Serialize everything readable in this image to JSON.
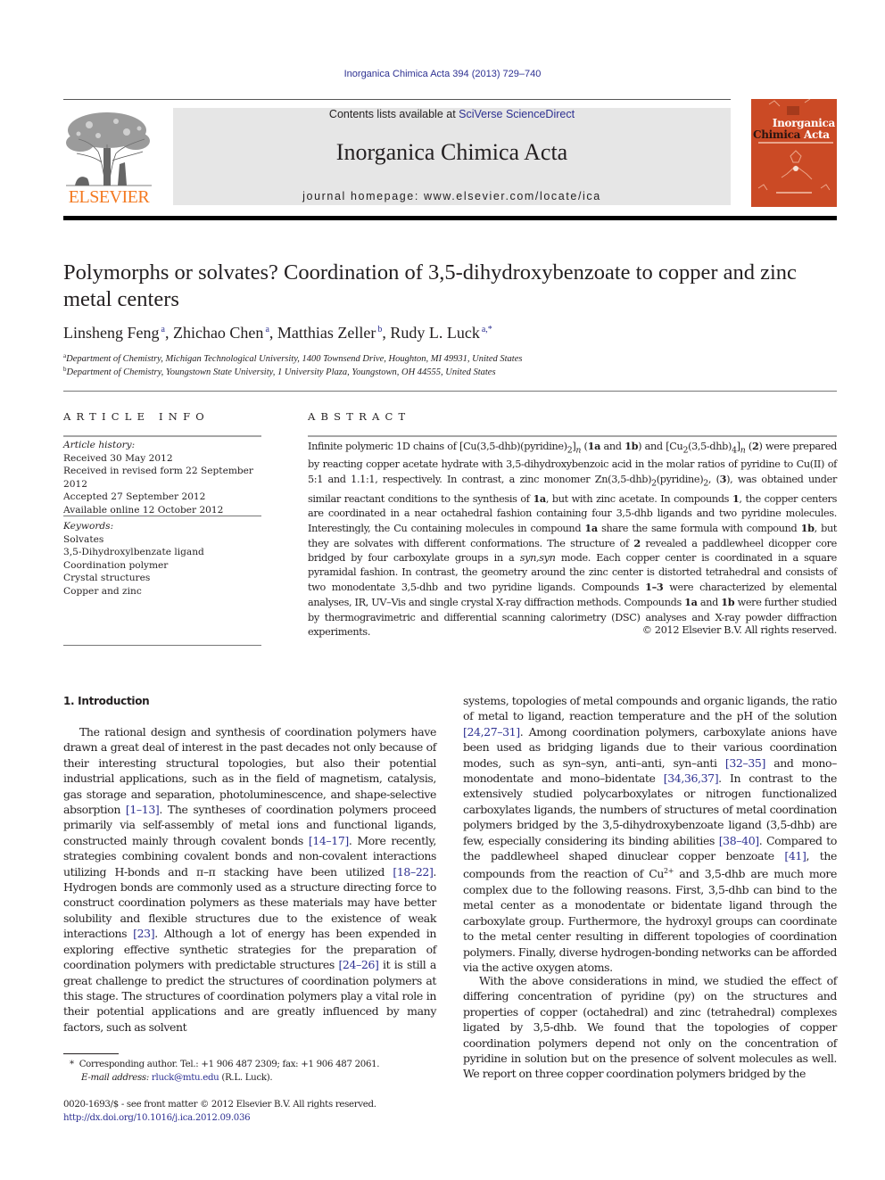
{
  "header": {
    "citation": "Inorganica Chimica Acta 394 (2013) 729–740",
    "publisher_logo_text": "ELSEVIER",
    "contents_prefix": "Contents lists available at ",
    "contents_link": "SciVerse ScienceDirect",
    "journal_title": "Inorganica Chimica Acta",
    "homepage_prefix": "journal homepage: ",
    "homepage_url": "www.elsevier.com/locate/ica",
    "cover": {
      "line1": "Inorganica",
      "line2_dark": "Chimica",
      "line2_light": " Acta",
      "color": "#cb4a25"
    },
    "logo_color": "#f47920",
    "link_color": "#2e3192"
  },
  "article": {
    "title": "Polymorphs or solvates? Coordination of 3,5-dihydroxybenzoate to copper and zinc metal centers",
    "authors": [
      {
        "name": "Linsheng Feng",
        "aff": "a"
      },
      {
        "name": "Zhichao Chen",
        "aff": "a"
      },
      {
        "name": "Matthias Zeller",
        "aff": "b"
      },
      {
        "name": "Rudy L. Luck",
        "aff": "a,*"
      }
    ],
    "affiliations": [
      {
        "mark": "a",
        "text": "Department of Chemistry, Michigan Technological University, 1400 Townsend Drive, Houghton, MI 49931, United States"
      },
      {
        "mark": "b",
        "text": "Department of Chemistry, Youngstown State University, 1 University Plaza, Youngstown, OH 44555, United States"
      }
    ]
  },
  "article_info": {
    "heading": "ARTICLE INFO",
    "history_label": "Article history:",
    "history": [
      "Received 30 May 2012",
      "Received in revised form 22 September 2012",
      "Accepted 27 September 2012",
      "Available online 12 October 2012"
    ],
    "keywords_label": "Keywords:",
    "keywords": [
      "Solvates",
      "3,5-Dihydroxylbenzate ligand",
      "Coordination polymer",
      "Crystal structures",
      "Copper and zinc"
    ]
  },
  "abstract": {
    "heading": "ABSTRACT",
    "segments": {
      "s1": "Infinite polymeric 1D chains of [Cu(3,5-dhb)(pyridine)",
      "s1_sub": "2",
      "s1b": "]",
      "s1_n": "n",
      "s2": " (",
      "b1a": "1a",
      "s3": " and ",
      "b1b": "1b",
      "s4": ") and [Cu",
      "s4_sub": "2",
      "s5": "(3,5-dhb)",
      "s5_sub": "4",
      "s5b": "]",
      "s5_n": "n",
      "s6": " (",
      "b2": "2",
      "s7": ") were prepared by reacting copper acetate hydrate with 3,5-dihydroxybenzoic acid in the molar ratios of pyridine to Cu(II) of 5:1 and 1.1:1, respectively. In contrast, a zinc monomer Zn(3,5-dhb)",
      "s7_sub": "2",
      "s8": "(pyridine)",
      "s8_sub": "2",
      "s9": ", (",
      "b3": "3",
      "s10": "), was obtained under similar reactant conditions to the synthesis of ",
      "b1a_2": "1a",
      "s11": ", but with zinc acetate. In compounds ",
      "b1": "1",
      "s12": ", the copper centers are coordinated in a near octahedral fashion containing four 3,5-dhb ligands and two pyridine molecules. Interestingly, the Cu containing molecules in compound ",
      "b1a_3": "1a",
      "s13": " share the same formula with compound ",
      "b1b_2": "1b",
      "s14": ", but they are solvates with different conformations. The structure of ",
      "b2_2": "2",
      "s15": " revealed a paddlewheel dicopper core bridged by four carboxylate groups in a ",
      "i_synsyn": "syn,syn",
      "s16": " mode. Each copper center is coordinated in a square pyramidal fashion. In contrast, the geometry around the zinc center is distorted tetrahedral and consists of two monodentate 3,5-dhb and two pyridine ligands. Compounds ",
      "b13": "1–3",
      "s17": " were characterized by elemental analyses, IR, UV–Vis and single crystal X-ray diffraction methods. Compounds ",
      "b1a_4": "1a",
      "s18": " and ",
      "b1b_3": "1b",
      "s19": " were further studied by thermogravimetric and differential scanning calorimetry (DSC) analyses and X-ray powder diffraction experiments."
    },
    "copyright": "© 2012 Elsevier B.V. All rights reserved."
  },
  "body": {
    "section_heading": "1. Introduction",
    "left": {
      "t1": "The rational design and synthesis of coordination polymers have drawn a great deal of interest in the past decades not only because of their interesting structural topologies, but also their potential industrial applications, such as in the field of magnetism, catalysis, gas storage and separation, photoluminescence, and shape-selective absorption ",
      "r1": "[1–13]",
      "t2": ". The syntheses of coordination polymers proceed primarily via self-assembly of metal ions and functional ligands, constructed mainly through covalent bonds ",
      "r2": "[14–17]",
      "t3": ". More recently, strategies combining covalent bonds and non-covalent interactions utilizing H-bonds and π–π stacking have been utilized ",
      "r3": "[18–22]",
      "t4": ". Hydrogen bonds are commonly used as a structure directing force to construct coordination polymers as these materials may have better solubility and flexible structures due to the existence of weak interactions ",
      "r4": "[23]",
      "t5": ". Although a lot of energy has been expended in exploring effective synthetic strategies for the preparation of coordination polymers with predictable structures ",
      "r5": "[24–26]",
      "t6": " it is still a great challenge to predict the structures of coordination polymers at this stage. The structures of coordination polymers play a vital role in their potential applications and are greatly influenced by many factors, such as solvent"
    },
    "right1": {
      "t1": "systems, topologies of metal compounds and organic ligands, the ratio of metal to ligand, reaction temperature and the pH of the solution ",
      "r1": "[24,27–31]",
      "t2": ". Among coordination polymers, carboxylate anions have been used as bridging ligands due to their various coordination modes, such as syn–syn, anti–anti, syn–anti ",
      "r2": "[32–35]",
      "t3": " and mono–monodentate and mono–bidentate ",
      "r3": "[34,36,37]",
      "t4": ". In contrast to the extensively studied polycarboxylates or nitrogen functionalized carboxylates ligands, the numbers of structures of metal coordination polymers bridged by the 3,5-dihydroxybenzoate ligand (3,5-dhb) are few, especially considering its binding abilities ",
      "r4": "[38–40]",
      "t5": ". Compared to the paddlewheel shaped dinuclear copper benzoate ",
      "r5": "[41]",
      "t6": ", the compounds from the reaction of Cu",
      "sup": "2+",
      "t7": " and 3,5-dhb are much more complex due to the following reasons. First, 3,5-dhb can bind to the metal center as a monodentate or bidentate ligand through the carboxylate group. Furthermore, the hydroxyl groups can coordinate to the metal center resulting in different topologies of coordination polymers. Finally, diverse hydrogen-bonding networks can be afforded via the active oxygen atoms."
    },
    "right2": {
      "t1": "With the above considerations in mind, we studied the effect of differing concentration of pyridine (py) on the structures and properties of copper (octahedral) and zinc (tetrahedral) complexes ligated by 3,5-dhb. We found that the topologies of copper coordination polymers depend not only on the concentration of pyridine in solution but on the presence of solvent molecules as well. We report on three copper coordination polymers bridged by the"
    }
  },
  "footnotes": {
    "star": "*",
    "corresponding": "Corresponding author. Tel.: +1 906 487 2309; fax: +1 906 487 2061.",
    "email_label": "E-mail address:",
    "email": "rluck@mtu.edu",
    "email_suffix": " (R.L. Luck).",
    "issn_line": "0020-1693/$ - see front matter © 2012 Elsevier B.V. All rights reserved.",
    "doi": "http://dx.doi.org/10.1016/j.ica.2012.09.036"
  }
}
